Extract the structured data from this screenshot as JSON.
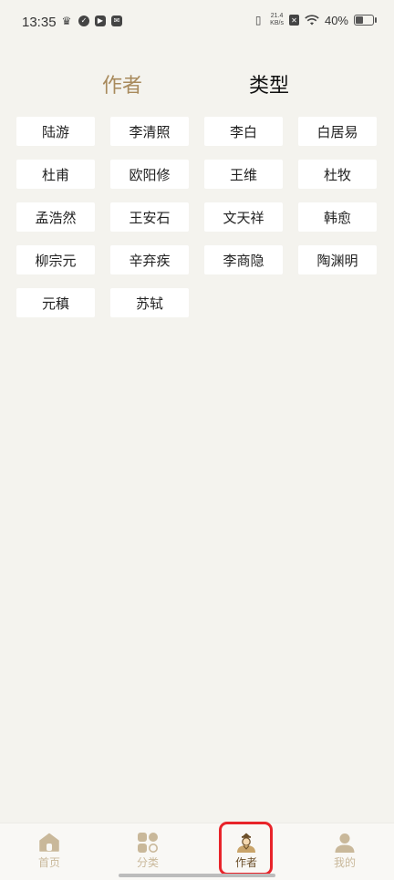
{
  "status_bar": {
    "time": "13:35",
    "net_speed_value": "21.4",
    "net_speed_unit": "KB/s",
    "battery_percent": "40%",
    "battery_level": 0.4
  },
  "top_tabs": {
    "author": "作者",
    "type": "类型"
  },
  "authors": [
    "陆游",
    "李清照",
    "李白",
    "白居易",
    "杜甫",
    "欧阳修",
    "王维",
    "杜牧",
    "孟浩然",
    "王安石",
    "文天祥",
    "韩愈",
    "柳宗元",
    "辛弃疾",
    "李商隐",
    "陶渊明",
    "元稹",
    "苏轼"
  ],
  "bottom_nav": {
    "home": "首页",
    "category": "分类",
    "author": "作者",
    "mine": "我的",
    "active": "author"
  },
  "colors": {
    "accent": "#a88a5c",
    "nav_inactive": "#c9b89a",
    "nav_active": "#6b4f2a",
    "highlight": "#e8242a",
    "background": "#f4f3ee"
  }
}
